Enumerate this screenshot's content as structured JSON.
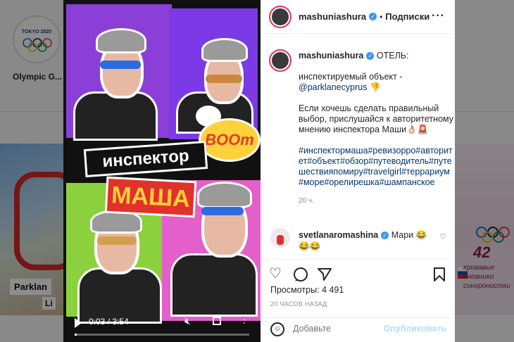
{
  "background": {
    "story_label": "Olympic G...",
    "story_logo_text": "TOKYO 2020",
    "thumb_left_text1": "Parklan",
    "thumb_left_text2": "Li",
    "thumb_right_number": "42",
    "thumb_right_text": "кровавые дневники синхронистки"
  },
  "video": {
    "banner_1": "инспектор",
    "banner_2": "МАША",
    "boom": "BOOm",
    "time": "0:03 / 3:54",
    "progress": 0.013
  },
  "post": {
    "username": "mashuniashura",
    "follow_label": "Подписки",
    "dot": "•",
    "caption": {
      "username": "mashuniashura",
      "line1": "ОТЕЛЬ:",
      "line2": "инспектируемый объект -",
      "mention": "@parklanecyprus",
      "mention_emoji": "👎",
      "para2": "Если хочешь сделать правильный выбор, прислушайся к авторитетному мнению инспектора Маши👌🏼🚨",
      "hashtags": "#инспектормаша#ревизорро#авторитет#объект#обзор#путеводитель#путешествияпомиру#travelgirl#террариум#море#орелирешка#шампанское",
      "age": "20 ч."
    },
    "comment": {
      "username": "svetlanaromashina",
      "text": "Мари 😂😂😂"
    },
    "views_label": "Просмотры:",
    "views_count": "4 491",
    "posted_ago": "20 ЧАСОВ НАЗАД",
    "comment_placeholder": "Добавьте",
    "publish_label": "Опубликовать"
  },
  "colors": {
    "accent": "#3897f0",
    "link": "#00376b",
    "muted": "#8e8e8e",
    "publish_disabled": "#b2dffc"
  }
}
